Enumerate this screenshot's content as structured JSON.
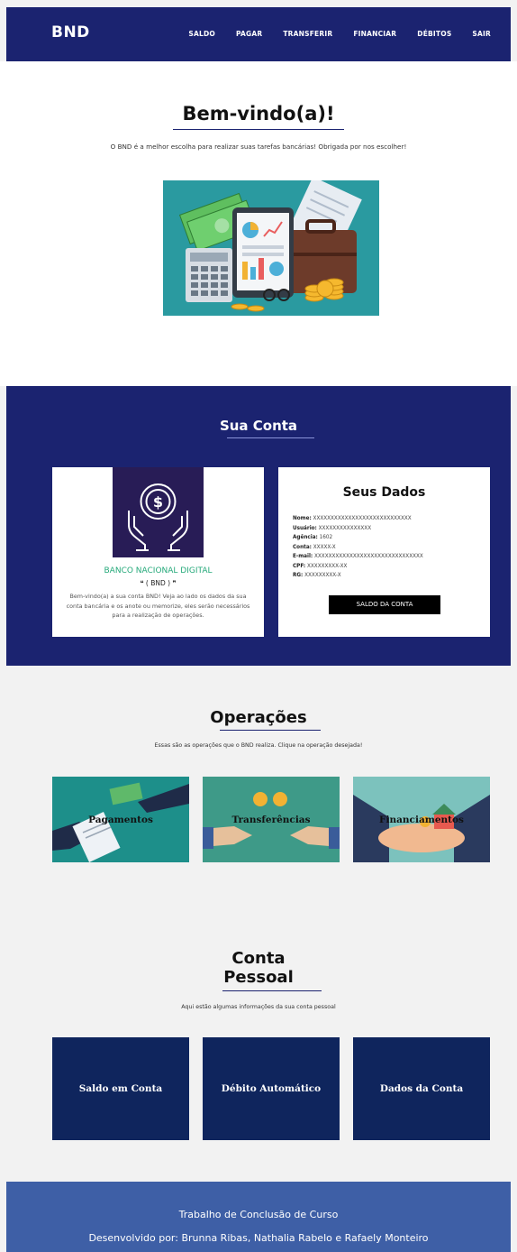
{
  "nav": {
    "brand": "BND",
    "items": [
      "SALDO",
      "PAGAR",
      "TRANSFERIR",
      "FINANCIAR",
      "DÉBITOS",
      "SAIR"
    ]
  },
  "welcome": {
    "title": "Bem-vindo(a)!",
    "text": "O BND é a melhor escolha para realizar suas tarefas bancárias! Obrigada por nos escolher!"
  },
  "conta": {
    "title": "Sua Conta",
    "bank_name": "BANCO NACIONAL DIGITAL",
    "bank_sub": "❝ ( BND ) ❞",
    "bank_desc": "Bem-vindo(a) a sua conta BND! Veja ao lado os dados da sua conta bancária e os anote ou memorize, eles serão necessários para a realização de operações.",
    "dados_title": "Seus Dados",
    "fields": [
      {
        "label": "Nome:",
        "value": "XXXXXXXXXXXXXXXXXXXXXXXXXXXX"
      },
      {
        "label": "Usuário:",
        "value": "XXXXXXXXXXXXXXX"
      },
      {
        "label": "Agência:",
        "value": "1602"
      },
      {
        "label": "Conta:",
        "value": "XXXXX-X"
      },
      {
        "label": "E-mail:",
        "value": "XXXXXXXXXXXXXXXXXXXXXXXXXXXXXXX"
      },
      {
        "label": "CPF:",
        "value": "XXXXXXXXX-XX"
      },
      {
        "label": "RG:",
        "value": "XXXXXXXXX-X"
      }
    ],
    "saldo_button": "SALDO DA CONTA"
  },
  "operacoes": {
    "title": "Operações",
    "text": "Essas são as operações que o BND realiza. Clique na operação desejada!",
    "cards": [
      "Pagamentos",
      "Transferências",
      "Financiamentos"
    ]
  },
  "pessoal": {
    "title_line1": "Conta",
    "title_line2": "Pessoal",
    "text": "Aqui estão algumas informações da sua conta pessoal",
    "cards": [
      "Saldo em Conta",
      "Débito Automático",
      "Dados da Conta"
    ]
  },
  "footer": {
    "line1": "Trabalho de Conclusão de Curso",
    "line2": "Desenvolvido por: Brunna Ribas, Nathalia Rabelo e Rafaely Monteiro"
  },
  "colors": {
    "navy": "#1b2370",
    "green": "#25a97a",
    "dark_blue_card": "#0f255d",
    "footer_blue": "#3e5fa6"
  }
}
